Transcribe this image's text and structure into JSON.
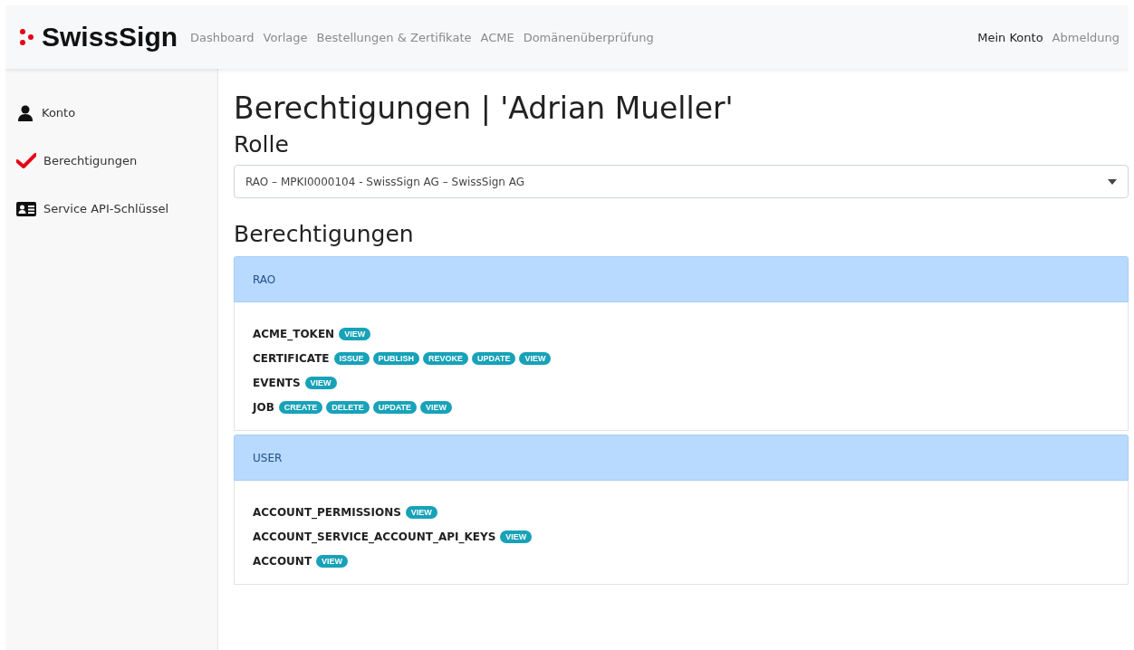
{
  "brand": {
    "name": "SwissSign"
  },
  "nav": [
    "Dashboard",
    "Vorlage",
    "Bestellungen & Zertifikate",
    "ACME",
    "Domänenüberprüfung"
  ],
  "user_nav": [
    "Mein Konto",
    "Abmeldung"
  ],
  "sidebar": {
    "items": [
      {
        "label": "Konto",
        "kind": "person"
      },
      {
        "label": "Berechtigungen",
        "kind": "check"
      },
      {
        "label": "Service API-Schlüssel",
        "kind": "card"
      }
    ]
  },
  "title": "Berechtigungen | 'Adrian Mueller'",
  "role_heading": "Rolle",
  "role_select": {
    "value": "RAO – MPKI0000104 - SwissSign AG – SwissSign AG"
  },
  "permissions_heading": "Berechtigungen",
  "groups": [
    {
      "name": "RAO",
      "permissions": [
        {
          "name": "ACME_TOKEN",
          "actions": [
            "VIEW"
          ]
        },
        {
          "name": "CERTIFICATE",
          "actions": [
            "ISSUE",
            "PUBLISH",
            "REVOKE",
            "UPDATE",
            "VIEW"
          ]
        },
        {
          "name": "EVENTS",
          "actions": [
            "VIEW"
          ]
        },
        {
          "name": "JOB",
          "actions": [
            "CREATE",
            "DELETE",
            "UPDATE",
            "VIEW"
          ]
        }
      ]
    },
    {
      "name": "USER",
      "permissions": [
        {
          "name": "ACCOUNT_PERMISSIONS",
          "actions": [
            "VIEW"
          ]
        },
        {
          "name": "ACCOUNT_SERVICE_ACCOUNT_API_KEYS",
          "actions": [
            "VIEW"
          ]
        },
        {
          "name": "ACCOUNT",
          "actions": [
            "VIEW"
          ]
        }
      ]
    }
  ]
}
